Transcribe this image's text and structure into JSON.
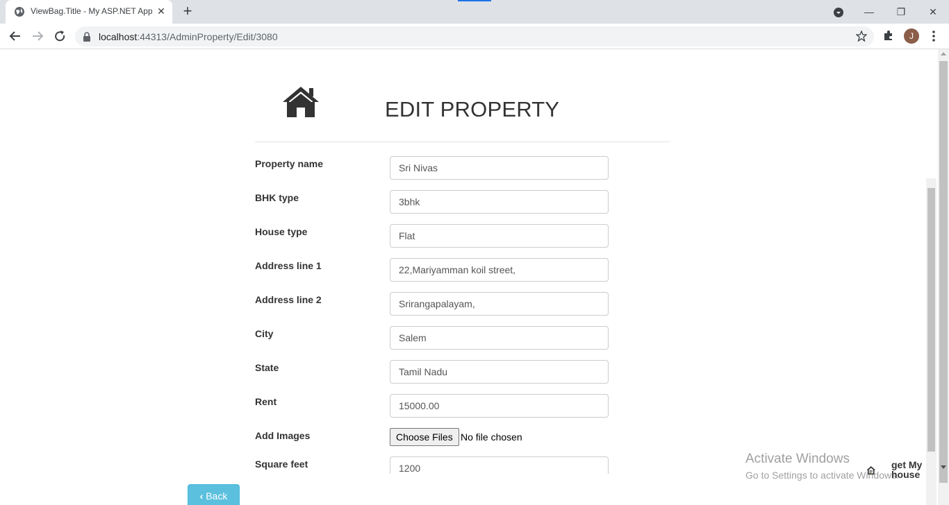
{
  "browser": {
    "tab_title": "ViewBag.Title - My ASP.NET Appl",
    "url_host": "localhost",
    "url_path": ":44313/AdminProperty/Edit/3080",
    "avatar_letter": "J"
  },
  "page": {
    "title": "EDIT PROPERTY",
    "fields": [
      {
        "label": "Property name",
        "value": "Sri Nivas"
      },
      {
        "label": "BHK type",
        "value": "3bhk"
      },
      {
        "label": "House type",
        "value": "Flat"
      },
      {
        "label": "Address line 1",
        "value": "22,Mariyamman koil street,"
      },
      {
        "label": "Address line 2",
        "value": "Srirangapalayam,"
      },
      {
        "label": "City",
        "value": "Salem"
      },
      {
        "label": "State",
        "value": "Tamil Nadu"
      },
      {
        "label": "Rent",
        "value": "15000.00"
      }
    ],
    "images": {
      "label": "Add Images",
      "button": "Choose Files",
      "status": "No file chosen"
    },
    "square_feet": {
      "label": "Square feet",
      "value": "1200"
    },
    "back_button": "Back"
  },
  "watermark": {
    "line1": "Activate Windows",
    "line2": "Go to Settings to activate Windows."
  },
  "logo": {
    "line1": "get My",
    "line2": "house"
  },
  "colors": {
    "accent": "#1a73e8",
    "back_button": "#5bc0de"
  }
}
